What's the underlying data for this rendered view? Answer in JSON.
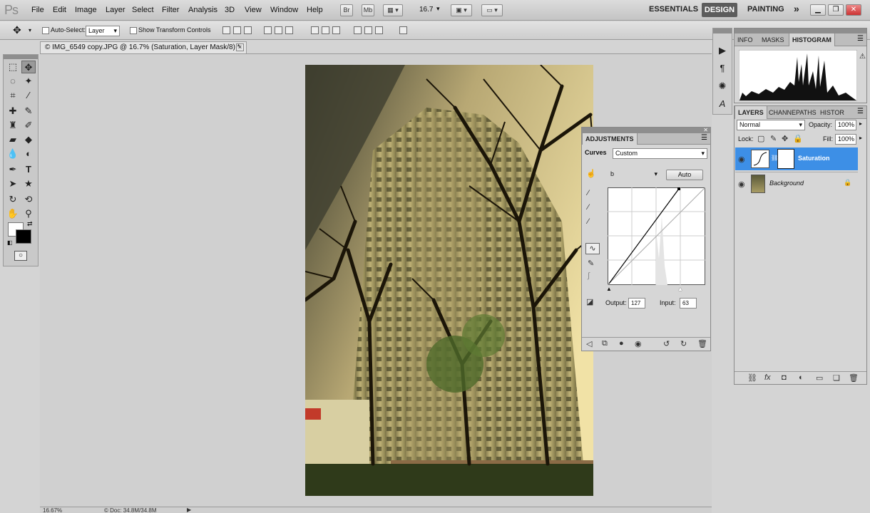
{
  "app": {
    "logo": "Ps",
    "menus": [
      "File",
      "Edit",
      "Image",
      "Layer",
      "Select",
      "Filter",
      "Analysis",
      "3D",
      "View",
      "Window",
      "Help"
    ],
    "app_buttons": [
      "Br",
      "Mb"
    ],
    "zoom_value": "16.7",
    "workspaces": {
      "essentials": "ESSENTIALS",
      "design": "DESIGN",
      "painting": "PAINTING",
      "more": "»"
    }
  },
  "options": {
    "auto_select_label": "Auto-Select:",
    "auto_select_value": "Layer",
    "transform_label": "Show Transform Controls"
  },
  "document": {
    "tab_title": "© IMG_6549 copy.JPG @ 16.7% (Saturation, Layer Mask/8) *",
    "close": "×"
  },
  "status": {
    "zoom": "16.67%",
    "doc": "© Doc: 34.8M/34.8M"
  },
  "histogram_panel": {
    "tabs": [
      "INFO",
      "MASKS",
      "HISTOGRAM"
    ],
    "active_tab": "HISTOGRAM"
  },
  "layers_panel": {
    "tabs": [
      "LAYERS",
      "CHANNE",
      "PATHS",
      "HISTOR"
    ],
    "blend_mode": "Normal",
    "opacity_label": "Opacity:",
    "opacity": "100%",
    "lock_label": "Lock:",
    "fill_label": "Fill:",
    "fill": "100%",
    "layers": [
      {
        "name": "Saturation",
        "selected": true
      },
      {
        "name": "Background",
        "selected": false
      }
    ]
  },
  "adjustments_panel": {
    "title": "ADJUSTMENTS",
    "preset_label": "Curves",
    "preset_value": "Custom",
    "channel": "b",
    "auto_label": "Auto",
    "output_label": "Output:",
    "output": "127",
    "input_label": "Input:",
    "input": "63"
  },
  "colors": {
    "selection": "#3d8fe6",
    "panel": "#d6d6d6"
  }
}
